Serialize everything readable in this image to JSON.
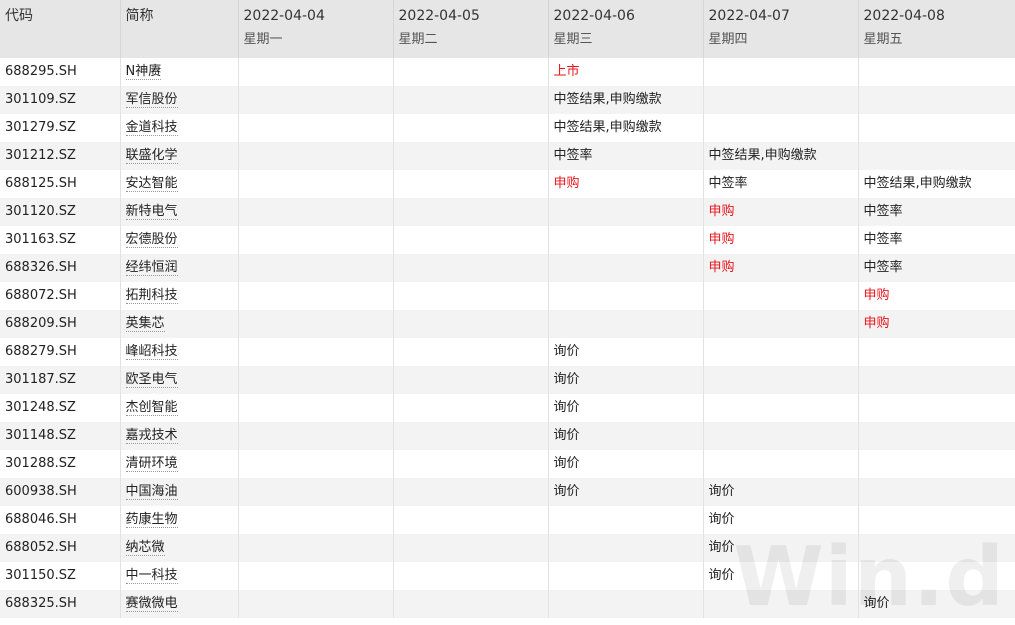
{
  "header": {
    "code_label": "代码",
    "name_label": "简称",
    "days": [
      {
        "date": "2022-04-04",
        "weekday": "星期一"
      },
      {
        "date": "2022-04-05",
        "weekday": "星期二"
      },
      {
        "date": "2022-04-06",
        "weekday": "星期三"
      },
      {
        "date": "2022-04-07",
        "weekday": "星期四"
      },
      {
        "date": "2022-04-08",
        "weekday": "星期五"
      }
    ]
  },
  "rows": [
    {
      "code": "688295.SH",
      "name": "N神赓",
      "events": [
        "",
        "",
        "上市",
        "",
        ""
      ],
      "colors": [
        "",
        "",
        "red",
        "",
        ""
      ]
    },
    {
      "code": "301109.SZ",
      "name": "军信股份",
      "events": [
        "",
        "",
        "中签结果,申购缴款",
        "",
        ""
      ],
      "colors": [
        "",
        "",
        "",
        "",
        ""
      ]
    },
    {
      "code": "301279.SZ",
      "name": "金道科技",
      "events": [
        "",
        "",
        "中签结果,申购缴款",
        "",
        ""
      ],
      "colors": [
        "",
        "",
        "",
        "",
        ""
      ]
    },
    {
      "code": "301212.SZ",
      "name": "联盛化学",
      "events": [
        "",
        "",
        "中签率",
        "中签结果,申购缴款",
        ""
      ],
      "colors": [
        "",
        "",
        "",
        "",
        ""
      ]
    },
    {
      "code": "688125.SH",
      "name": "安达智能",
      "events": [
        "",
        "",
        "申购",
        "中签率",
        "中签结果,申购缴款"
      ],
      "colors": [
        "",
        "",
        "red",
        "",
        ""
      ]
    },
    {
      "code": "301120.SZ",
      "name": "新特电气",
      "events": [
        "",
        "",
        "",
        "申购",
        "中签率"
      ],
      "colors": [
        "",
        "",
        "",
        "red",
        ""
      ]
    },
    {
      "code": "301163.SZ",
      "name": "宏德股份",
      "events": [
        "",
        "",
        "",
        "申购",
        "中签率"
      ],
      "colors": [
        "",
        "",
        "",
        "red",
        ""
      ]
    },
    {
      "code": "688326.SH",
      "name": "经纬恒润",
      "events": [
        "",
        "",
        "",
        "申购",
        "中签率"
      ],
      "colors": [
        "",
        "",
        "",
        "red",
        ""
      ]
    },
    {
      "code": "688072.SH",
      "name": "拓荆科技",
      "events": [
        "",
        "",
        "",
        "",
        "申购"
      ],
      "colors": [
        "",
        "",
        "",
        "",
        "red"
      ]
    },
    {
      "code": "688209.SH",
      "name": "英集芯",
      "events": [
        "",
        "",
        "",
        "",
        "申购"
      ],
      "colors": [
        "",
        "",
        "",
        "",
        "red"
      ]
    },
    {
      "code": "688279.SH",
      "name": "峰岹科技",
      "events": [
        "",
        "",
        "询价",
        "",
        ""
      ],
      "colors": [
        "",
        "",
        "",
        "",
        ""
      ]
    },
    {
      "code": "301187.SZ",
      "name": "欧圣电气",
      "events": [
        "",
        "",
        "询价",
        "",
        ""
      ],
      "colors": [
        "",
        "",
        "",
        "",
        ""
      ]
    },
    {
      "code": "301248.SZ",
      "name": "杰创智能",
      "events": [
        "",
        "",
        "询价",
        "",
        ""
      ],
      "colors": [
        "",
        "",
        "",
        "",
        ""
      ]
    },
    {
      "code": "301148.SZ",
      "name": "嘉戎技术",
      "events": [
        "",
        "",
        "询价",
        "",
        ""
      ],
      "colors": [
        "",
        "",
        "",
        "",
        ""
      ]
    },
    {
      "code": "301288.SZ",
      "name": "清研环境",
      "events": [
        "",
        "",
        "询价",
        "",
        ""
      ],
      "colors": [
        "",
        "",
        "",
        "",
        ""
      ]
    },
    {
      "code": "600938.SH",
      "name": "中国海油",
      "events": [
        "",
        "",
        "询价",
        "询价",
        ""
      ],
      "colors": [
        "",
        "",
        "",
        "",
        ""
      ]
    },
    {
      "code": "688046.SH",
      "name": "药康生物",
      "events": [
        "",
        "",
        "",
        "询价",
        ""
      ],
      "colors": [
        "",
        "",
        "",
        "",
        ""
      ]
    },
    {
      "code": "688052.SH",
      "name": "纳芯微",
      "events": [
        "",
        "",
        "",
        "询价",
        ""
      ],
      "colors": [
        "",
        "",
        "",
        "",
        ""
      ]
    },
    {
      "code": "301150.SZ",
      "name": "中一科技",
      "events": [
        "",
        "",
        "",
        "询价",
        ""
      ],
      "colors": [
        "",
        "",
        "",
        "",
        ""
      ]
    },
    {
      "code": "688325.SH",
      "name": "赛微微电",
      "events": [
        "",
        "",
        "",
        "",
        "询价"
      ],
      "colors": [
        "",
        "",
        "",
        "",
        ""
      ]
    }
  ],
  "watermark": "Win.d"
}
